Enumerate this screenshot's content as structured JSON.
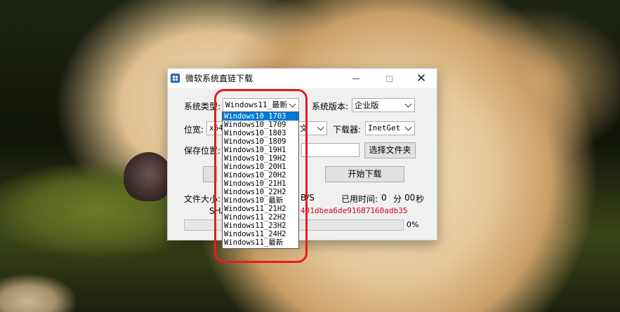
{
  "window": {
    "title": "微软系统直链下载"
  },
  "form": {
    "system_type_label": "系统类型:",
    "system_type_value": "Windows11_最新",
    "system_version_label": "系统版本:",
    "system_version_value": "企业版",
    "arch_label": "位宽:",
    "arch_value_partial": "x64",
    "language_value_partial": "文",
    "downloader_label": "下载器:",
    "downloader_value": "InetGet",
    "save_location_label": "保存位置:",
    "choose_folder_button": "选择文件夹",
    "start_download_button": "开始下载",
    "file_size_label": "文件大小:",
    "speed_partial": "B/S",
    "elapsed_label": "已用时间:",
    "elapsed_minutes": "0",
    "minutes_unit": "分",
    "elapsed_seconds": "00",
    "seconds_unit": "秒",
    "sha_label_partial": "SHA",
    "sha_value_partial": "401dbea6de91687160adb35",
    "progress_text": "0%",
    "progress_fraction": 0
  },
  "dropdown": {
    "selected_index": 0,
    "items": [
      "Windows10_1703",
      "Windows10_1709",
      "Windows10_1803",
      "Windows10_1809",
      "Windows10_19H1",
      "Windows10_19H2",
      "Windows10_20H1",
      "Windows10_20H2",
      "Windows10_21H1",
      "Windows10_22H2",
      "Windows10_最新",
      "Windows11_21H2",
      "Windows11_22H2",
      "Windows11_23H2",
      "Windows11_24H2",
      "Windows11_最新"
    ]
  },
  "colors": {
    "highlight": "#e51d1d",
    "selection": "#0078d7",
    "sha_text": "#d0021b",
    "progress_fill": "#06b025"
  }
}
